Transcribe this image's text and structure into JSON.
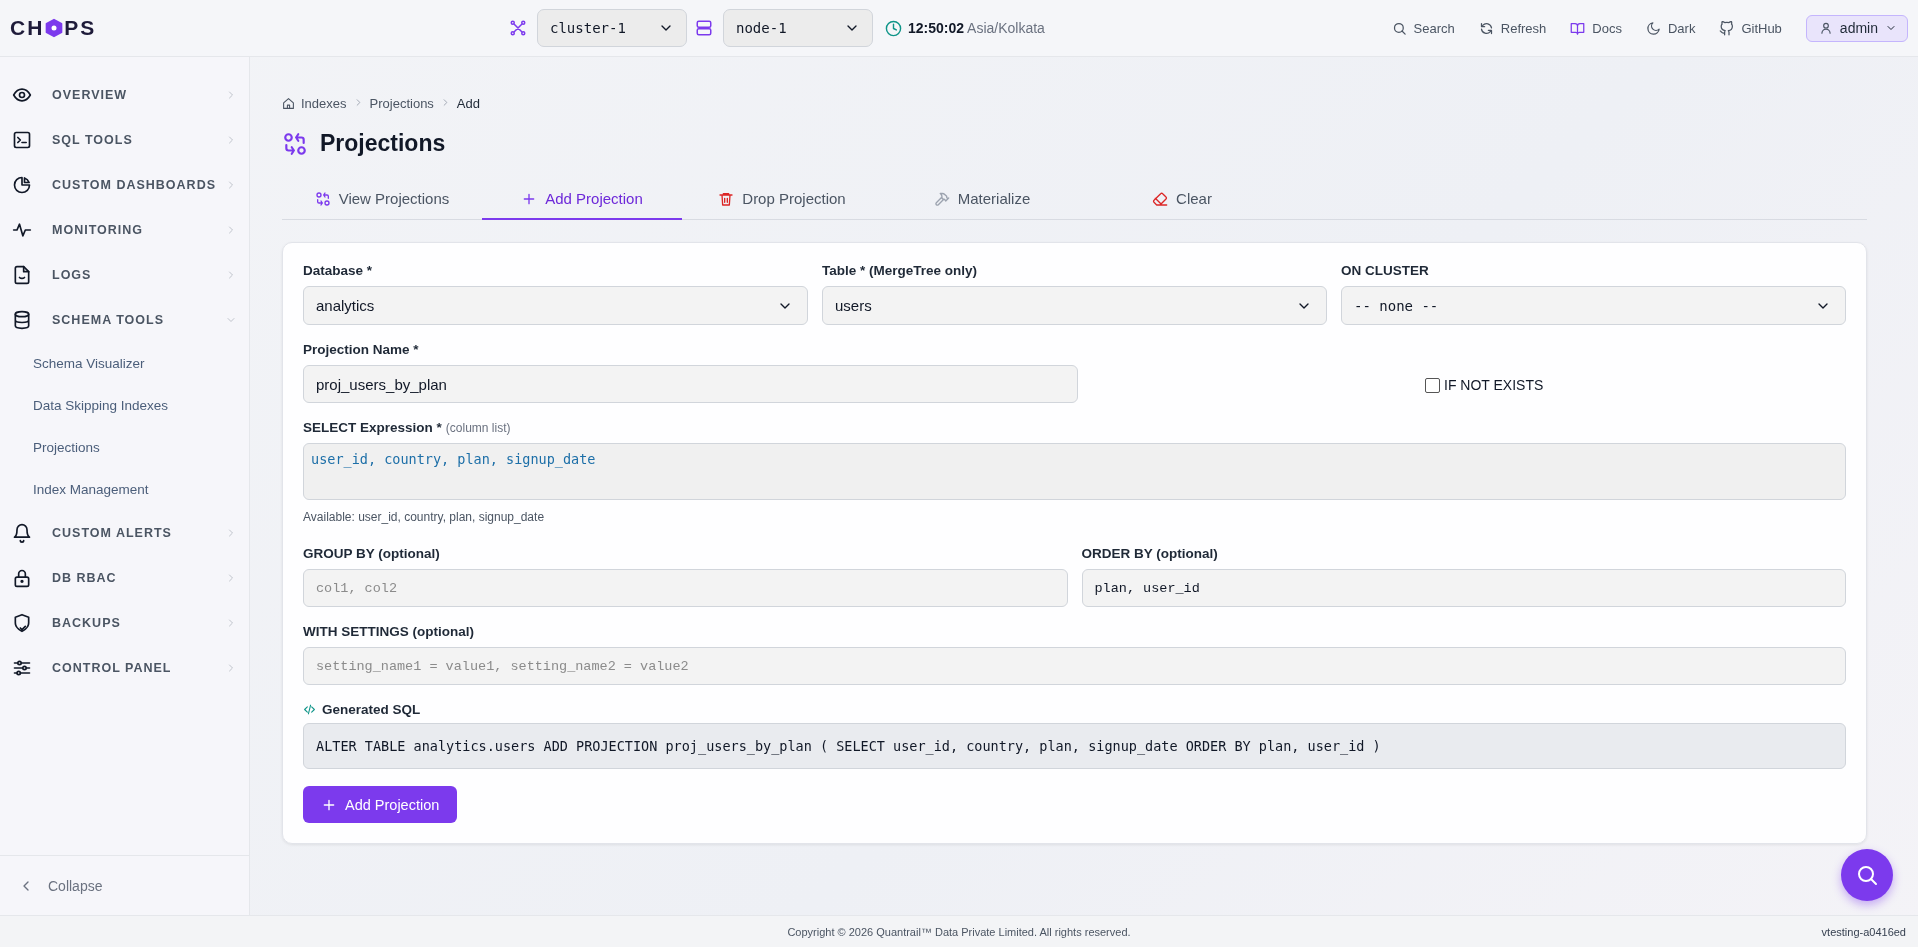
{
  "topbar": {
    "logo_left": "CH",
    "logo_right": "PS",
    "cluster": "cluster-1",
    "node": "node-1",
    "time": "12:50:02",
    "timezone": "Asia/Kolkata",
    "actions": [
      {
        "kind": "search",
        "label": "Search"
      },
      {
        "kind": "refresh",
        "label": "Refresh"
      },
      {
        "kind": "docs",
        "label": "Docs"
      },
      {
        "kind": "dark",
        "label": "Dark"
      },
      {
        "kind": "github",
        "label": "GitHub"
      }
    ],
    "user": "admin"
  },
  "sidebar": {
    "items": [
      {
        "kind": "eye",
        "label": "OVERVIEW",
        "expanded": false
      },
      {
        "kind": "terminal",
        "label": "SQL TOOLS",
        "expanded": false
      },
      {
        "kind": "pie",
        "label": "CUSTOM DASHBOARDS",
        "expanded": false
      },
      {
        "kind": "pulse",
        "label": "MONITORING",
        "expanded": false
      },
      {
        "kind": "file",
        "label": "LOGS",
        "expanded": false
      },
      {
        "kind": "database",
        "label": "SCHEMA TOOLS",
        "expanded": true,
        "children": [
          {
            "label": "Schema Visualizer"
          },
          {
            "label": "Data Skipping Indexes"
          },
          {
            "label": "Projections"
          },
          {
            "label": "Index Management"
          }
        ]
      },
      {
        "kind": "bell",
        "label": "CUSTOM ALERTS",
        "expanded": false
      },
      {
        "kind": "lock",
        "label": "DB RBAC",
        "expanded": false
      },
      {
        "kind": "shield",
        "label": "BACKUPS",
        "expanded": false
      },
      {
        "kind": "sliders",
        "label": "CONTROL PANEL",
        "expanded": false
      }
    ],
    "collapse": "Collapse"
  },
  "breadcrumb": [
    "Indexes",
    "Projections",
    "Add"
  ],
  "page_title": "Projections",
  "tabs": [
    {
      "kind": "view",
      "label": "View Projections",
      "selected": false
    },
    {
      "kind": "add",
      "label": "Add Projection",
      "selected": true
    },
    {
      "kind": "drop",
      "label": "Drop Projection",
      "selected": false
    },
    {
      "kind": "materialize",
      "label": "Materialize",
      "selected": false
    },
    {
      "kind": "clear",
      "label": "Clear",
      "selected": false
    }
  ],
  "form": {
    "database": {
      "label": "Database *",
      "value": "analytics"
    },
    "table": {
      "label": "Table * (MergeTree only)",
      "value": "users"
    },
    "on_cluster": {
      "label": "ON CLUSTER",
      "value": "-- none --"
    },
    "projection_name": {
      "label": "Projection Name *",
      "value": "proj_users_by_plan"
    },
    "if_not_exists": {
      "label": "IF NOT EXISTS",
      "checked": false
    },
    "select_expression": {
      "label": "SELECT Expression *",
      "hint": "(column list)",
      "value": "user_id, country, plan, signup_date",
      "available": "Available: user_id, country, plan, signup_date"
    },
    "group_by": {
      "label": "GROUP BY (optional)",
      "placeholder": "col1, col2"
    },
    "order_by": {
      "label": "ORDER BY (optional)",
      "value": "plan, user_id"
    },
    "with_settings": {
      "label": "WITH SETTINGS (optional)",
      "placeholder": "setting_name1 = value1, setting_name2 = value2"
    },
    "generated_sql": {
      "label": "Generated SQL",
      "value": "ALTER TABLE analytics.users ADD PROJECTION proj_users_by_plan ( SELECT user_id, country, plan, signup_date ORDER BY plan, user_id )"
    },
    "submit": "Add Projection"
  },
  "footer": {
    "copyright": "Copyright © 2026 Quantrail™ Data Private Limited. All rights reserved.",
    "version": "vtesting-a0416ed"
  }
}
